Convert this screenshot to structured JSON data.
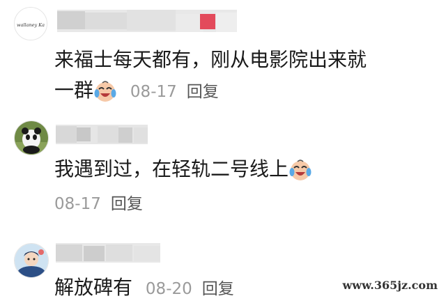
{
  "comments": [
    {
      "avatar_icon": "brand-logo-avatar",
      "avatar_text": "wallaney Ka",
      "text_line1": "来福士每天都有，刚从电影院出来就",
      "text_line2": "一群",
      "emoji": "crying-laughing-emoji",
      "date": "08-17",
      "reply_label": "回复"
    },
    {
      "avatar_icon": "panda-avatar",
      "text_line1": "我遇到过，在轻轨二号线上",
      "emoji": "crying-laughing-emoji",
      "date": "08-17",
      "reply_label": "回复"
    },
    {
      "avatar_icon": "cartoon-avatar",
      "text_line1": "解放碑有",
      "date": "08-20",
      "reply_label": "回复"
    }
  ],
  "watermark": "www.365jz.com",
  "colors": {
    "text": "#1a1a1a",
    "meta": "#9a9a9a",
    "blur": "#d8d8d8",
    "blur_accent": "#e34a5b"
  }
}
